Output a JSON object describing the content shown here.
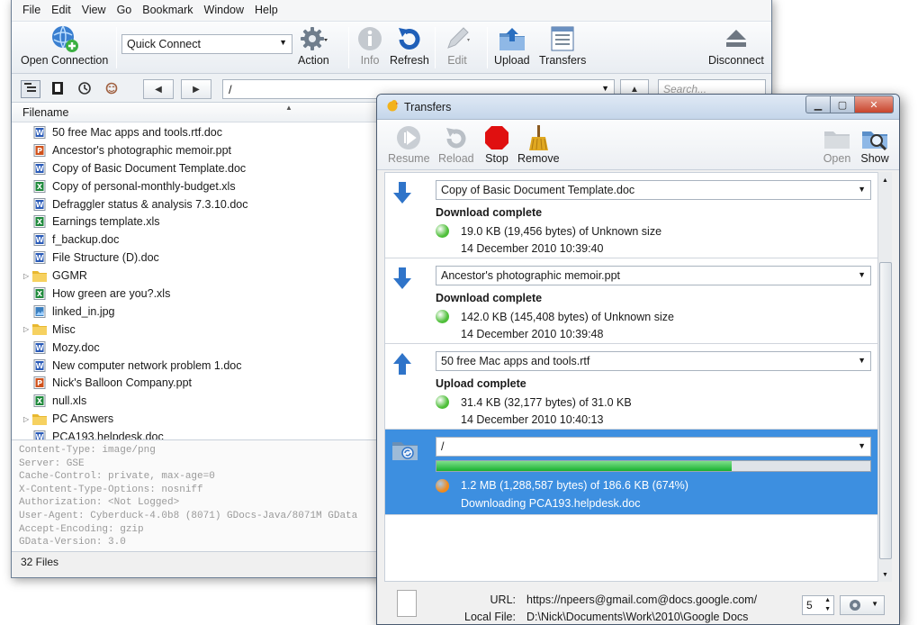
{
  "main": {
    "menu": [
      "File",
      "Edit",
      "View",
      "Go",
      "Bookmark",
      "Window",
      "Help"
    ],
    "toolbar": {
      "open_connection": "Open Connection",
      "quick_connect": "Quick Connect",
      "action": "Action",
      "info": "Info",
      "refresh": "Refresh",
      "edit": "Edit",
      "upload": "Upload",
      "transfers": "Transfers",
      "disconnect": "Disconnect"
    },
    "nav": {
      "back": "◀",
      "forward": "▶",
      "up": "▲",
      "path": "/",
      "search_placeholder": "Search..."
    },
    "column_header": "Filename",
    "files": [
      {
        "name": "50 free Mac apps and tools.rtf.doc",
        "type": "word"
      },
      {
        "name": "Ancestor's photographic memoir.ppt",
        "type": "ppt"
      },
      {
        "name": "Copy of Basic Document Template.doc",
        "type": "word"
      },
      {
        "name": "Copy of personal-monthly-budget.xls",
        "type": "excel"
      },
      {
        "name": "Defraggler status & analysis 7.3.10.doc",
        "type": "word"
      },
      {
        "name": "Earnings template.xls",
        "type": "excel"
      },
      {
        "name": "f_backup.doc",
        "type": "word"
      },
      {
        "name": "File Structure (D).doc",
        "type": "word"
      },
      {
        "name": "GGMR",
        "type": "folder"
      },
      {
        "name": "How green are you?.xls",
        "type": "excel"
      },
      {
        "name": "linked_in.jpg",
        "type": "image"
      },
      {
        "name": "Misc",
        "type": "folder"
      },
      {
        "name": "Mozy.doc",
        "type": "word"
      },
      {
        "name": "New computer network problem 1.doc",
        "type": "word"
      },
      {
        "name": "Nick's Balloon Company.ppt",
        "type": "ppt"
      },
      {
        "name": "null.xls",
        "type": "excel"
      },
      {
        "name": "PC Answers",
        "type": "folder"
      },
      {
        "name": "PCA193.helpdesk.doc",
        "type": "word"
      }
    ],
    "log_lines": [
      "Content-Type: image/png",
      "Server: GSE",
      "Cache-Control: private, max-age=0",
      "X-Content-Type-Options: nosniff",
      "Authorization: <Not Logged>",
      "User-Agent: Cyberduck-4.0b8 (8071) GDocs-Java/8071M GData",
      "Accept-Encoding: gzip",
      "GData-Version: 3.0"
    ],
    "status": "32 Files"
  },
  "transfers": {
    "title": "Transfers",
    "toolbar": {
      "resume": "Resume",
      "reload": "Reload",
      "stop": "Stop",
      "remove": "Remove",
      "open": "Open",
      "show": "Show"
    },
    "items": [
      {
        "direction": "download",
        "file": "Copy of Basic Document Template.doc",
        "status": "Download complete",
        "size": "19.0 KB (19,456 bytes) of Unknown size",
        "date": "14 December 2010 10:39:40",
        "dot": "green"
      },
      {
        "direction": "download",
        "file": "Ancestor's photographic memoir.ppt",
        "status": "Download complete",
        "size": "142.0 KB (145,408 bytes) of Unknown size",
        "date": "14 December 2010 10:39:48",
        "dot": "green"
      },
      {
        "direction": "upload",
        "file": "50 free Mac apps and tools.rtf",
        "status": "Upload complete",
        "size": "31.4 KB (32,177 bytes) of 31.0 KB",
        "date": "14 December 2010 10:40:13",
        "dot": "green"
      },
      {
        "direction": "sync",
        "file": "/",
        "progress": 0.68,
        "size": "1.2 MB (1,288,587 bytes) of 186.6 KB (674%)",
        "date": "Downloading PCA193.helpdesk.doc",
        "dot": "orange"
      }
    ],
    "bottom": {
      "url_label": "URL:",
      "url_value": "https://npeers@gmail.com@docs.google.com/",
      "local_label": "Local File:",
      "local_value": "D:\\Nick\\Documents\\Work\\2010\\Google Docs",
      "connections": "5"
    },
    "colors": {
      "selection": "#3d8fe0",
      "green_dot": "#4fbf3a",
      "orange_dot": "#f08a1c"
    }
  }
}
